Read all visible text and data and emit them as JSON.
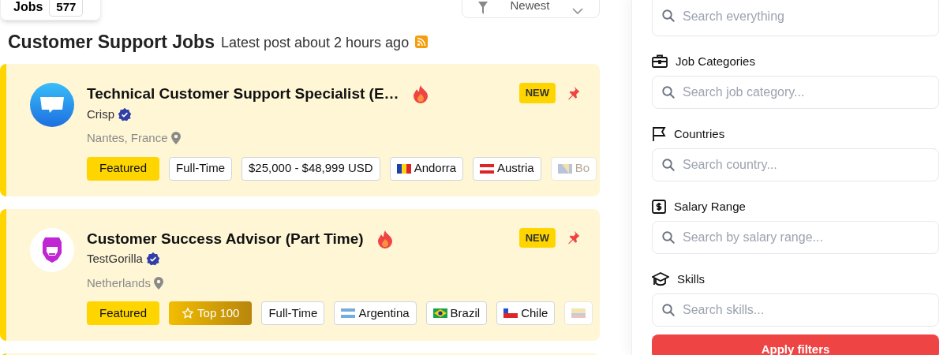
{
  "toolbar": {
    "jobs_label": "Jobs",
    "jobs_count": "577",
    "sort": "Newest"
  },
  "heading": {
    "title": "Customer Support Jobs",
    "subtitle": "Latest post about 2 hours ago"
  },
  "jobs": [
    {
      "title": "Technical Customer Support Specialist (E…",
      "company": "Crisp",
      "verified": true,
      "location": "Nantes, France",
      "hot": true,
      "badge": "NEW",
      "pinned": true,
      "logo": {
        "kind": "chat"
      },
      "tags": [
        {
          "kind": "featured",
          "label": "Featured"
        },
        {
          "kind": "plain",
          "label": "Full-Time"
        },
        {
          "kind": "plain",
          "label": "$25,000 - $48,999 USD"
        },
        {
          "kind": "country",
          "label": "Andorra",
          "faded": false,
          "flag": {
            "kind": "vertical",
            "stripes": [
              {
                "color": "#1e40af"
              },
              {
                "color": "#fcd116"
              },
              {
                "color": "#dc2626"
              }
            ]
          }
        },
        {
          "kind": "country",
          "label": "Austria",
          "faded": false,
          "flag": {
            "kind": "horizontal",
            "stripes": [
              {
                "color": "#dc2626"
              },
              {
                "color": "#ffffff"
              },
              {
                "color": "#dc2626"
              }
            ]
          }
        },
        {
          "kind": "country",
          "label": "Bo",
          "faded": true,
          "flag": {
            "kind": "diagonal"
          }
        }
      ]
    },
    {
      "title": "Customer Success Advisor (Part Time)",
      "company": "TestGorilla",
      "verified": true,
      "location": "Netherlands",
      "hot": true,
      "badge": "NEW",
      "pinned": true,
      "logo": {
        "kind": "gorilla"
      },
      "tags": [
        {
          "kind": "featured",
          "label": "Featured"
        },
        {
          "kind": "top",
          "label": "Top 100"
        },
        {
          "kind": "plain",
          "label": "Full-Time"
        },
        {
          "kind": "country",
          "label": "Argentina",
          "faded": false,
          "flag": {
            "kind": "horizontal",
            "stripes": [
              {
                "color": "#74acdf"
              },
              {
                "color": "#ffffff"
              },
              {
                "color": "#74acdf"
              }
            ]
          }
        },
        {
          "kind": "country",
          "label": "Brazil",
          "faded": false,
          "flag": {
            "kind": "diamond",
            "stripes": [
              {
                "color": "#16a34a"
              },
              {
                "color": "#facc15"
              },
              {
                "color": "#1e3a8a"
              }
            ]
          }
        },
        {
          "kind": "country",
          "label": "Chile",
          "faded": false,
          "flag": {
            "kind": "canton",
            "stripes": [
              {
                "color": "#ffffff"
              },
              {
                "color": "#dc2626"
              },
              {
                "color": "#1d4ed8"
              }
            ]
          }
        },
        {
          "kind": "flag",
          "faded": true,
          "flag": {
            "kind": "tricolor"
          }
        }
      ]
    }
  ],
  "sidebar": {
    "search_placeholder": "Search everything",
    "filters": [
      {
        "kind": "categories",
        "label": "Job Categories",
        "placeholder": "Search job category..."
      },
      {
        "kind": "countries",
        "label": "Countries",
        "placeholder": "Search country..."
      },
      {
        "kind": "salary",
        "label": "Salary Range",
        "placeholder": "Search by salary range..."
      },
      {
        "kind": "skills",
        "label": "Skills",
        "placeholder": "Search skills..."
      }
    ],
    "apply": "Apply filters"
  }
}
